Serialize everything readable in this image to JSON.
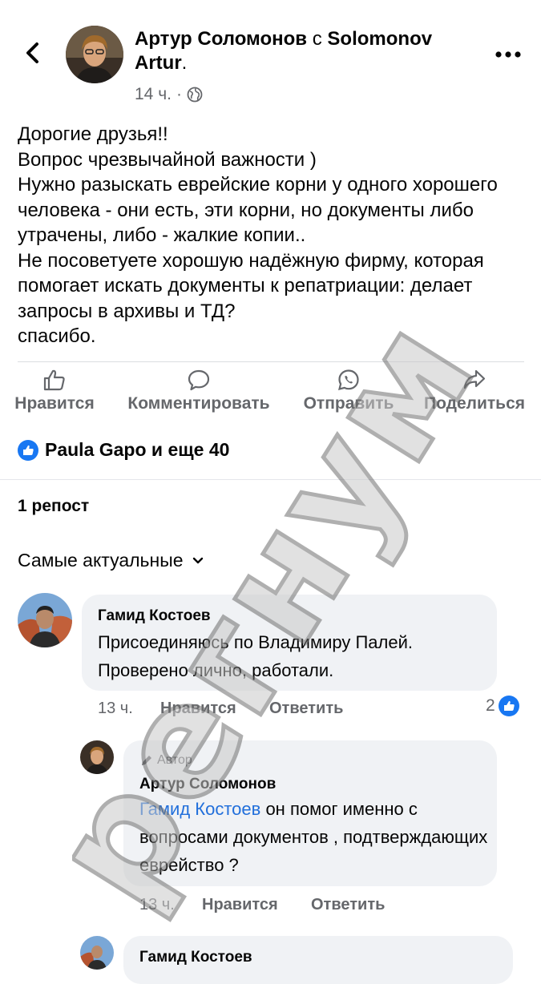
{
  "header": {
    "author": "Артур Соломонов",
    "with_word": "с",
    "tagged": "Solomonov Artur",
    "tagged_suffix": ".",
    "time": "14 ч.",
    "dot": "·"
  },
  "post": {
    "text": "Дорогие друзья!!\nВопрос чрезвычайной важности )\nНужно разыскать еврейские корни у одного хорошего человека - они есть, эти корни, но документы либо утрачены, либо - жалкие копии..\nНе посоветуете хорошую надёжную фирму, которая помогает искать документы к репатриации: делает запросы в архивы и ТД?\nспасибо."
  },
  "actions": {
    "like": "Нравится",
    "comment": "Комментировать",
    "send": "Отправить",
    "share": "Поделиться"
  },
  "reactions": {
    "summary": "Paula Gapo и еще 40"
  },
  "reposts": "1 репост",
  "sort": "Самые актуальные",
  "comments": [
    {
      "name": "Гамид Костоев",
      "text": "Присоединяюсь по Владимиру Палей. Проверено лично, работали.",
      "time": "13 ч.",
      "like": "Нравится",
      "reply": "Ответить",
      "reactions": "2"
    },
    {
      "badge": "Автор",
      "name": "Артур Соломонов",
      "mention": "Гамид Костоев",
      "text": " он помог именно с вопросами документов , подтверждающих еврейство ?",
      "time": "13 ч.",
      "like": "Нравится",
      "reply": "Ответить"
    },
    {
      "name": "Гамид Костоев"
    }
  ],
  "watermark": "регнум",
  "colors": {
    "accent": "#1877f2",
    "muted": "#65676b",
    "bubble": "#f0f2f5",
    "link": "#216fdb"
  }
}
